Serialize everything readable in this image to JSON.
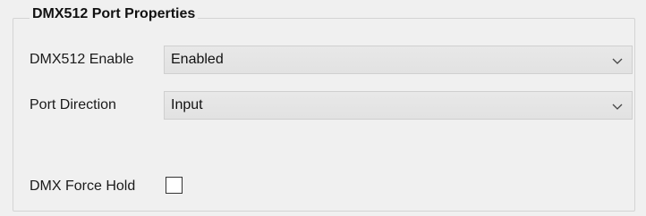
{
  "group": {
    "title": "DMX512 Port Properties"
  },
  "fields": {
    "dmx_enable": {
      "label": "DMX512 Enable",
      "value": "Enabled"
    },
    "port_direction": {
      "label": "Port Direction",
      "value": "Input"
    },
    "force_hold": {
      "label": "DMX Force Hold",
      "checked": false
    }
  },
  "icons": {
    "dropdown": "chevron-down-icon"
  }
}
